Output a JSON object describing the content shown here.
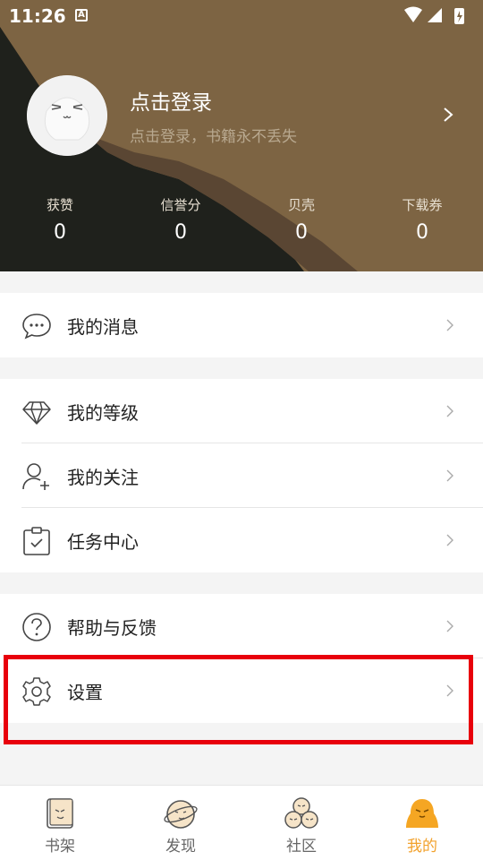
{
  "status_bar": {
    "time": "11:26",
    "indicator": "A"
  },
  "profile": {
    "title": "点击登录",
    "subtitle": "点击登录，书籍永不丢失"
  },
  "stats": [
    {
      "label": "获赞",
      "value": "0"
    },
    {
      "label": "信誉分",
      "value": "0"
    },
    {
      "label": "贝壳",
      "value": "0"
    },
    {
      "label": "下载券",
      "value": "0"
    }
  ],
  "menu": {
    "messages": "我的消息",
    "level": "我的等级",
    "follow": "我的关注",
    "tasks": "任务中心",
    "help": "帮助与反馈",
    "settings": "设置"
  },
  "bottom_nav": [
    {
      "label": "书架",
      "icon": "bookshelf-icon"
    },
    {
      "label": "发现",
      "icon": "discover-icon"
    },
    {
      "label": "社区",
      "icon": "community-icon"
    },
    {
      "label": "我的",
      "icon": "profile-icon",
      "active": true
    }
  ],
  "colors": {
    "accent": "#f2a12b",
    "header_bg": "#7d6443",
    "highlight": "#e8000b"
  }
}
